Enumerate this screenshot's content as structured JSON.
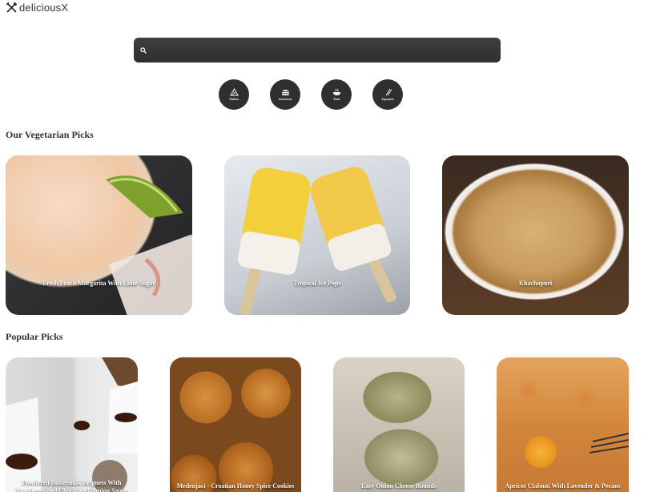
{
  "brand": {
    "name": "deliciousX",
    "icon": "fork-knife-icon"
  },
  "search": {
    "icon": "search-icon",
    "value": ""
  },
  "categories": [
    {
      "label": "Italian",
      "icon": "pizza-icon"
    },
    {
      "label": "American",
      "icon": "burger-icon"
    },
    {
      "label": "Thai",
      "icon": "bowl-icon"
    },
    {
      "label": "Japanese",
      "icon": "chopsticks-icon"
    }
  ],
  "sections": {
    "vegetarian": {
      "title": "Our Vegetarian Picks",
      "items": [
        {
          "title": "Fresh Peach Margarita With Lime Sugar"
        },
        {
          "title": "Tropical Ice Pops"
        },
        {
          "title": "Khachapuri"
        }
      ]
    },
    "popular": {
      "title": "Popular Picks",
      "items": [
        {
          "title": "Powdered Buttermilk Beignets With Raspberry and Chocolate Dipping Sauce"
        },
        {
          "title": "Medenjaci - Croatian Honey Spice Cookies"
        },
        {
          "title": "Easy Onion Cheese Rounds"
        },
        {
          "title": "Apricot Clafouti With Lavender & Pecans"
        }
      ]
    }
  }
}
